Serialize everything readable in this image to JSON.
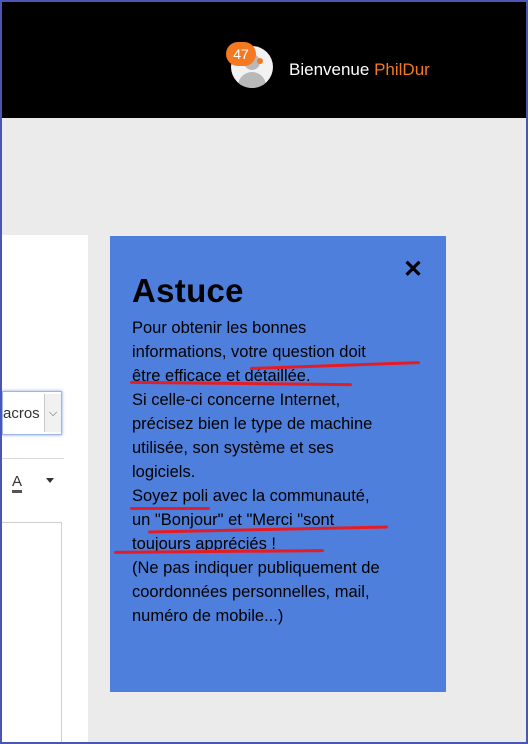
{
  "header": {
    "notification_count": "47",
    "welcome_label": "Bienvenue",
    "username": "PhilDur"
  },
  "editor": {
    "font_select_value": "acros",
    "format_button": "A"
  },
  "tip": {
    "title": "Astuce",
    "close_symbol": "✕",
    "lines": [
      "Pour obtenir les bonnes",
      "informations, votre question doit",
      "être efficace et détaillée.",
      "Si celle-ci concerne Internet,",
      "précisez bien le type de machine",
      "utilisée, son système et ses",
      "logiciels.",
      "Soyez poli avec la communauté,",
      "un \"Bonjour\" et \"Merci \"sont",
      "toujours appréciés !",
      "(Ne pas indiquer publiquement de",
      "coordonnées personnelles, mail,",
      "numéro de mobile...)"
    ]
  },
  "colors": {
    "accent": "#f47920",
    "tip_background": "#4f7fdc",
    "annotation_red": "#e61c25",
    "topbar": "#000000"
  }
}
